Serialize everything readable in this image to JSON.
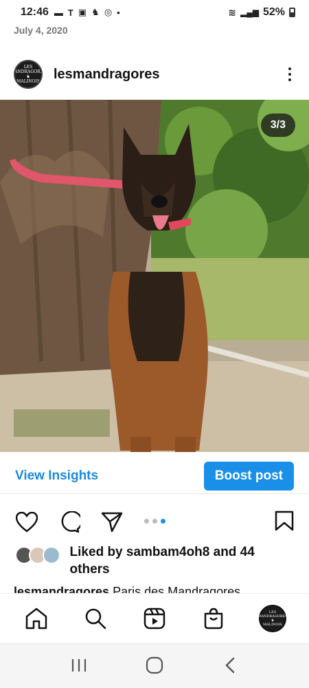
{
  "status_bar": {
    "time": "12:46",
    "battery": "52%",
    "notification_icons": [
      "message-icon",
      "t-mobile-icon",
      "translate-icon",
      "cat-icon",
      "instagram-icon",
      "dot-icon"
    ]
  },
  "date": "July 4, 2020",
  "post": {
    "username": "lesmandragores",
    "avatar_text": "LES MANDRAGORES MALINOIS",
    "image_counter": "3/3"
  },
  "insights": {
    "view_label": "View Insights",
    "boost_label": "Boost post"
  },
  "carousel": {
    "total": 3,
    "active": 3
  },
  "likes": {
    "text": "Liked by sambam4oh8 and 44 others"
  },
  "caption": {
    "username": "lesmandragores",
    "text": "Paris des Mandragores"
  },
  "colors": {
    "accent": "#1a8fe8",
    "link": "#1a8ae0"
  }
}
